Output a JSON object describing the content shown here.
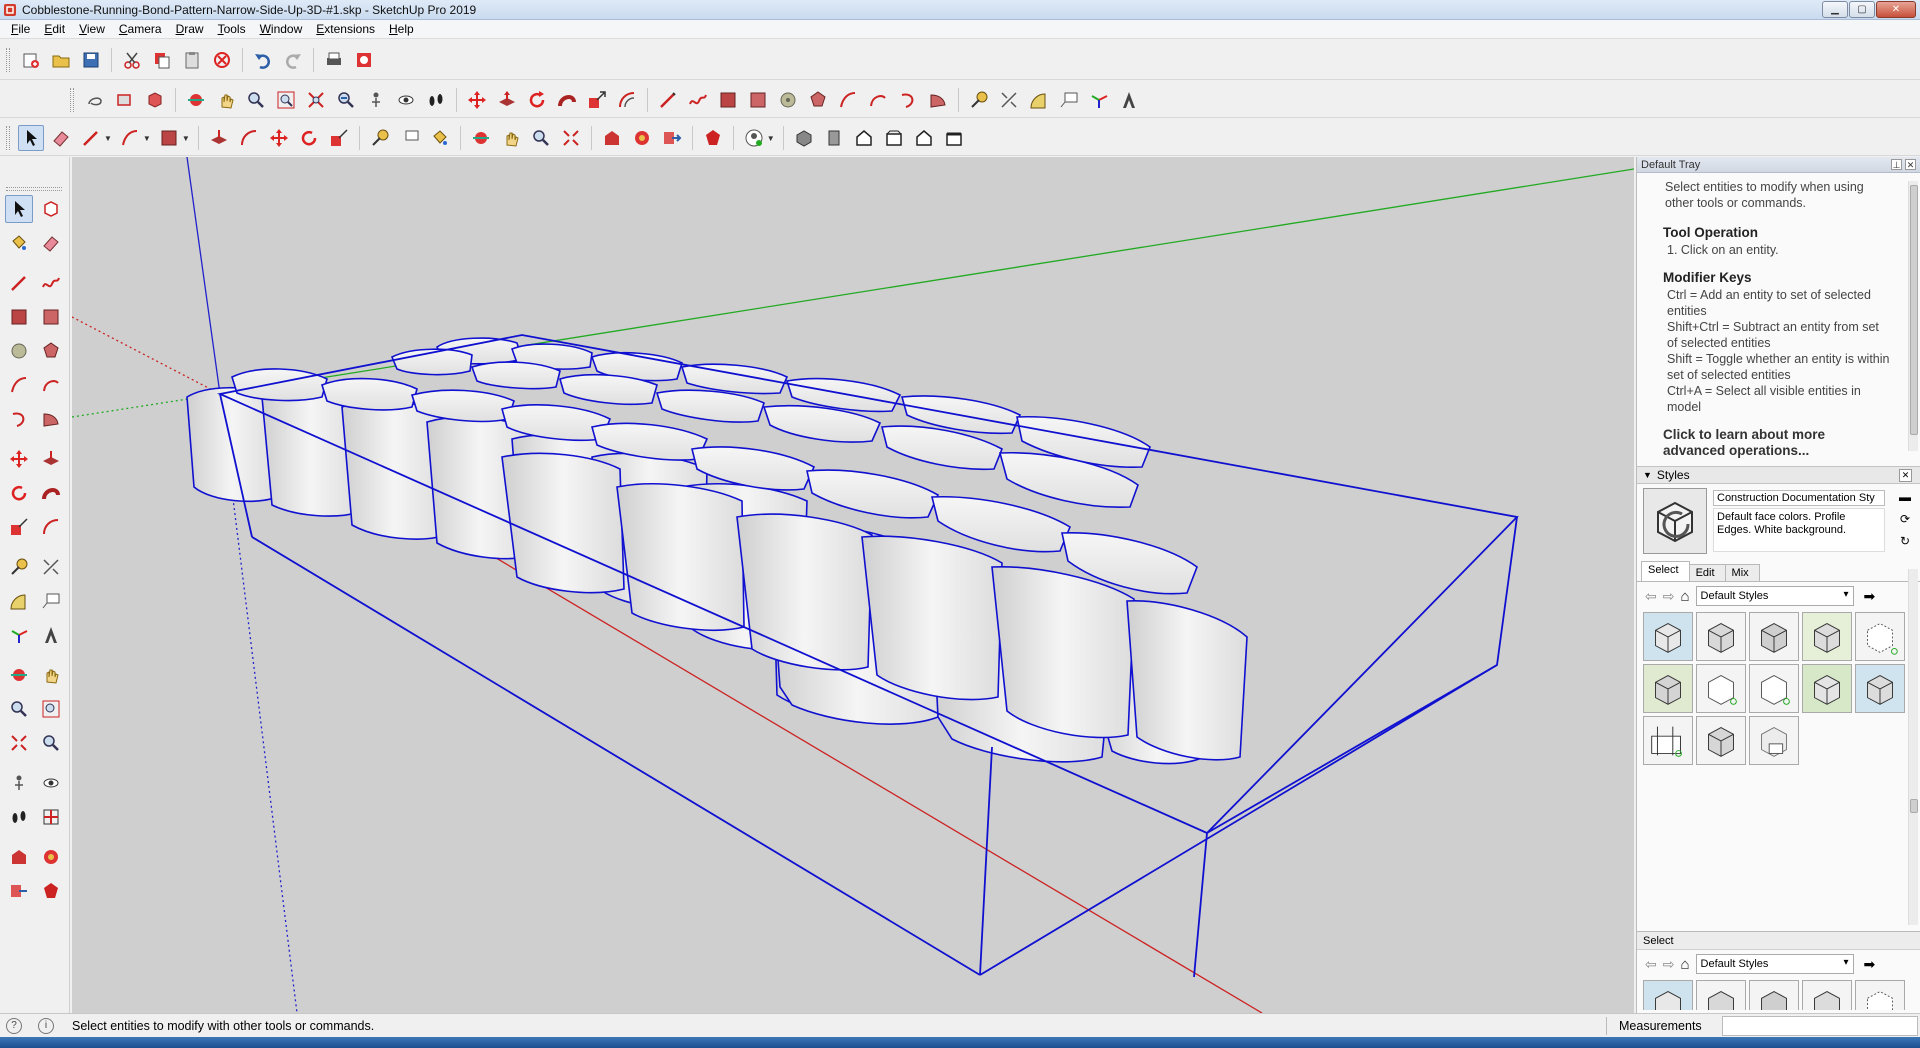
{
  "window": {
    "title": "Cobblestone-Running-Bond-Pattern-Narrow-Side-Up-3D-#1.skp - SketchUp Pro 2019",
    "minimize_glyph": "▁",
    "maximize_glyph": "▢",
    "close_glyph": "✕"
  },
  "menu": [
    "File",
    "Edit",
    "View",
    "Camera",
    "Draw",
    "Tools",
    "Window",
    "Extensions",
    "Help"
  ],
  "tray": {
    "title": "Default Tray",
    "pin_glyph": "⊥",
    "close_glyph": "✕",
    "instructor": {
      "lead": "Select entities to modify when using other tools or commands.",
      "tool_operation_title": "Tool Operation",
      "tool_operation_step": "1. Click on an entity.",
      "modifier_keys_title": "Modifier Keys",
      "modifier_1": "Ctrl = Add an entity to set of selected entities",
      "modifier_2": "Shift+Ctrl = Subtract an entity from set of selected entities",
      "modifier_3": "Shift = Toggle whether an entity is within set of selected entities",
      "modifier_4": "Ctrl+A = Select all visible entities in model",
      "learn_more": "Click to learn about more advanced operations..."
    },
    "styles": {
      "panel_title": "Styles",
      "close_glyph": "✕",
      "style_name": "Construction Documentation Sty",
      "style_description": "Default face colors. Profile Edges. White background.",
      "tabs": [
        "Select",
        "Edit",
        "Mix"
      ],
      "back_glyph": "⇦",
      "forward_glyph": "⇨",
      "home_glyph": "⌂",
      "details_glyph": "➡",
      "library": "Default Styles",
      "secondary_pane_label": "Select",
      "secondary_library": "Default Styles"
    }
  },
  "status": {
    "message": "Select entities to modify with other tools or commands.",
    "measurements_label": "Measurements",
    "icon_1": "?",
    "icon_2": "i"
  },
  "colors": {
    "viewport_bg": "#cfcfcf",
    "selection_blue": "#1010d0",
    "axis_red": "#cc2222",
    "axis_green": "#22aa22",
    "axis_blue": "#2222cc"
  }
}
